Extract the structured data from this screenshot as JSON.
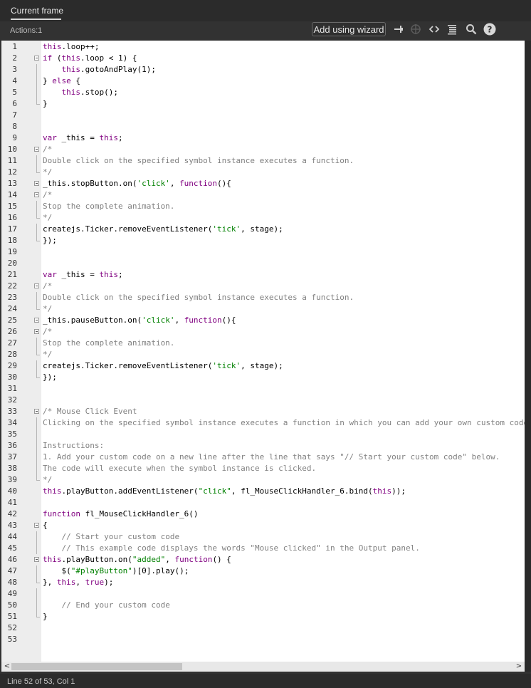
{
  "tab": {
    "label": "Current frame"
  },
  "toolbar": {
    "actions_label": "Actions:1",
    "wizard_label": "Add using wizard"
  },
  "status": {
    "text": "Line 52 of 53, Col 1"
  },
  "scrollbar": {
    "left_arrow": "<",
    "right_arrow": ">"
  },
  "colors": {
    "keyword": "#800080",
    "string": "#008000",
    "comment": "#808080"
  },
  "code_lines": [
    {
      "n": "1",
      "fold": "",
      "tokens": [
        [
          "kw",
          "this"
        ],
        [
          "",
          "."
        ],
        [
          "",
          "loop++;"
        ]
      ]
    },
    {
      "n": "2",
      "fold": "open",
      "tokens": [
        [
          "kw",
          "if"
        ],
        [
          "",
          " ("
        ],
        [
          "kw",
          "this"
        ],
        [
          "",
          ".loop < 1) {"
        ]
      ]
    },
    {
      "n": "3",
      "fold": "bar",
      "tokens": [
        [
          "",
          "    "
        ],
        [
          "kw",
          "this"
        ],
        [
          "",
          ".gotoAndPlay(1);"
        ]
      ]
    },
    {
      "n": "4",
      "fold": "bar",
      "tokens": [
        [
          "",
          "} "
        ],
        [
          "kw",
          "else"
        ],
        [
          "",
          " {"
        ]
      ]
    },
    {
      "n": "5",
      "fold": "bar",
      "tokens": [
        [
          "",
          "    "
        ],
        [
          "kw",
          "this"
        ],
        [
          "",
          ".stop();"
        ]
      ]
    },
    {
      "n": "6",
      "fold": "end",
      "tokens": [
        [
          "",
          "}"
        ]
      ]
    },
    {
      "n": "7",
      "fold": "",
      "tokens": []
    },
    {
      "n": "8",
      "fold": "",
      "tokens": []
    },
    {
      "n": "9",
      "fold": "",
      "tokens": [
        [
          "kw",
          "var"
        ],
        [
          "",
          " _this = "
        ],
        [
          "kw",
          "this"
        ],
        [
          "",
          ";"
        ]
      ]
    },
    {
      "n": "10",
      "fold": "open",
      "tokens": [
        [
          "cm",
          "/*"
        ]
      ]
    },
    {
      "n": "11",
      "fold": "bar",
      "tokens": [
        [
          "cm",
          "Double click on the specified symbol instance executes a function."
        ]
      ]
    },
    {
      "n": "12",
      "fold": "end",
      "tokens": [
        [
          "cm",
          "*/"
        ]
      ]
    },
    {
      "n": "13",
      "fold": "open",
      "tokens": [
        [
          "",
          "_this.stopButton.on("
        ],
        [
          "str",
          "'click'"
        ],
        [
          "",
          ", "
        ],
        [
          "kw",
          "function"
        ],
        [
          "",
          "(){"
        ]
      ]
    },
    {
      "n": "14",
      "fold": "open",
      "tokens": [
        [
          "cm",
          "/*"
        ]
      ]
    },
    {
      "n": "15",
      "fold": "bar",
      "tokens": [
        [
          "cm",
          "Stop the complete animation."
        ]
      ]
    },
    {
      "n": "16",
      "fold": "end",
      "tokens": [
        [
          "cm",
          "*/"
        ]
      ]
    },
    {
      "n": "17",
      "fold": "bar",
      "tokens": [
        [
          "",
          "createjs.Ticker.removeEventListener("
        ],
        [
          "str",
          "'tick'"
        ],
        [
          "",
          ", stage);"
        ]
      ]
    },
    {
      "n": "18",
      "fold": "end",
      "tokens": [
        [
          "",
          "});"
        ]
      ]
    },
    {
      "n": "19",
      "fold": "",
      "tokens": []
    },
    {
      "n": "20",
      "fold": "",
      "tokens": []
    },
    {
      "n": "21",
      "fold": "",
      "tokens": [
        [
          "kw",
          "var"
        ],
        [
          "",
          " _this = "
        ],
        [
          "kw",
          "this"
        ],
        [
          "",
          ";"
        ]
      ]
    },
    {
      "n": "22",
      "fold": "open",
      "tokens": [
        [
          "cm",
          "/*"
        ]
      ]
    },
    {
      "n": "23",
      "fold": "bar",
      "tokens": [
        [
          "cm",
          "Double click on the specified symbol instance executes a function."
        ]
      ]
    },
    {
      "n": "24",
      "fold": "end",
      "tokens": [
        [
          "cm",
          "*/"
        ]
      ]
    },
    {
      "n": "25",
      "fold": "open",
      "tokens": [
        [
          "",
          "_this.pauseButton.on("
        ],
        [
          "str",
          "'click'"
        ],
        [
          "",
          ", "
        ],
        [
          "kw",
          "function"
        ],
        [
          "",
          "(){"
        ]
      ]
    },
    {
      "n": "26",
      "fold": "open",
      "tokens": [
        [
          "cm",
          "/*"
        ]
      ]
    },
    {
      "n": "27",
      "fold": "bar",
      "tokens": [
        [
          "cm",
          "Stop the complete animation."
        ]
      ]
    },
    {
      "n": "28",
      "fold": "end",
      "tokens": [
        [
          "cm",
          "*/"
        ]
      ]
    },
    {
      "n": "29",
      "fold": "bar",
      "tokens": [
        [
          "",
          "createjs.Ticker.removeEventListener("
        ],
        [
          "str",
          "'tick'"
        ],
        [
          "",
          ", stage);"
        ]
      ]
    },
    {
      "n": "30",
      "fold": "end",
      "tokens": [
        [
          "",
          "});"
        ]
      ]
    },
    {
      "n": "31",
      "fold": "",
      "tokens": []
    },
    {
      "n": "32",
      "fold": "",
      "tokens": []
    },
    {
      "n": "33",
      "fold": "open",
      "tokens": [
        [
          "cm",
          "/* Mouse Click Event"
        ]
      ]
    },
    {
      "n": "34",
      "fold": "bar",
      "tokens": [
        [
          "cm",
          "Clicking on the specified symbol instance executes a function in which you can add your own custom code."
        ]
      ]
    },
    {
      "n": "35",
      "fold": "bar",
      "tokens": []
    },
    {
      "n": "36",
      "fold": "bar",
      "tokens": [
        [
          "cm",
          "Instructions:"
        ]
      ]
    },
    {
      "n": "37",
      "fold": "bar",
      "tokens": [
        [
          "cm",
          "1. Add your custom code on a new line after the line that says \"// Start your custom code\" below."
        ]
      ]
    },
    {
      "n": "38",
      "fold": "bar",
      "tokens": [
        [
          "cm",
          "The code will execute when the symbol instance is clicked."
        ]
      ]
    },
    {
      "n": "39",
      "fold": "end",
      "tokens": [
        [
          "cm",
          "*/"
        ]
      ]
    },
    {
      "n": "40",
      "fold": "",
      "tokens": [
        [
          "kw",
          "this"
        ],
        [
          "",
          ".playButton.addEventListener("
        ],
        [
          "str",
          "\"click\""
        ],
        [
          "",
          ", fl_MouseClickHandler_6.bind("
        ],
        [
          "kw",
          "this"
        ],
        [
          "",
          "));"
        ]
      ]
    },
    {
      "n": "41",
      "fold": "",
      "tokens": []
    },
    {
      "n": "42",
      "fold": "",
      "tokens": [
        [
          "kw",
          "function"
        ],
        [
          "",
          " fl_MouseClickHandler_6()"
        ]
      ]
    },
    {
      "n": "43",
      "fold": "open",
      "tokens": [
        [
          "",
          "{"
        ]
      ]
    },
    {
      "n": "44",
      "fold": "bar",
      "tokens": [
        [
          "",
          "    "
        ],
        [
          "cm",
          "// Start your custom code"
        ]
      ]
    },
    {
      "n": "45",
      "fold": "bar",
      "tokens": [
        [
          "",
          "    "
        ],
        [
          "cm",
          "// This example code displays the words \"Mouse clicked\" in the Output panel."
        ]
      ]
    },
    {
      "n": "46",
      "fold": "open",
      "tokens": [
        [
          "kw",
          "this"
        ],
        [
          "",
          ".playButton.on("
        ],
        [
          "str",
          "\"added\""
        ],
        [
          "",
          ", "
        ],
        [
          "kw",
          "function"
        ],
        [
          "",
          "() {"
        ]
      ]
    },
    {
      "n": "47",
      "fold": "bar",
      "tokens": [
        [
          "",
          "    $("
        ],
        [
          "str",
          "\"#playButton\""
        ],
        [
          "",
          ")[0].play();"
        ]
      ]
    },
    {
      "n": "48",
      "fold": "end",
      "tokens": [
        [
          "",
          "}, "
        ],
        [
          "kw",
          "this"
        ],
        [
          "",
          ", "
        ],
        [
          "kw",
          "true"
        ],
        [
          "",
          ");"
        ]
      ]
    },
    {
      "n": "49",
      "fold": "bar",
      "tokens": []
    },
    {
      "n": "50",
      "fold": "bar",
      "tokens": [
        [
          "",
          "    "
        ],
        [
          "cm",
          "// End your custom code"
        ]
      ]
    },
    {
      "n": "51",
      "fold": "end",
      "tokens": [
        [
          "",
          "}"
        ]
      ]
    },
    {
      "n": "52",
      "fold": "",
      "tokens": []
    },
    {
      "n": "53",
      "fold": "",
      "tokens": []
    }
  ]
}
